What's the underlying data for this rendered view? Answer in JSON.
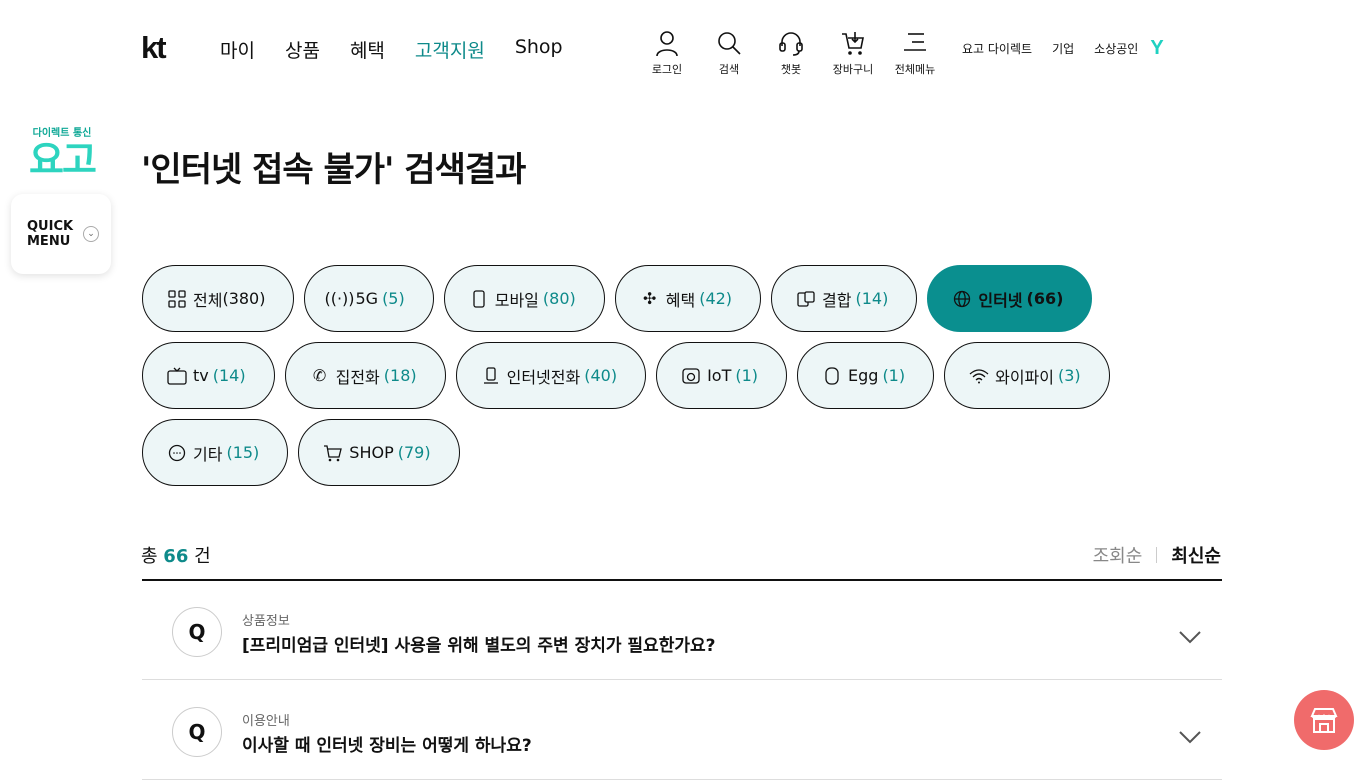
{
  "header": {
    "logo": "kt",
    "gnb": [
      "마이",
      "상품",
      "혜택",
      "고객지원",
      "Shop"
    ],
    "util": [
      {
        "label": "로그인",
        "icon": "user-icon"
      },
      {
        "label": "검색",
        "icon": "search-icon"
      },
      {
        "label": "챗봇",
        "icon": "headset-icon"
      },
      {
        "label": "장바구니",
        "icon": "cart-icon"
      },
      {
        "label": "전체메뉴",
        "icon": "menu-icon"
      }
    ],
    "toplinks": [
      "요고 다이렉트",
      "기업",
      "소상공인"
    ],
    "y_logo": "Y"
  },
  "quick": {
    "badge_small": "다이렉트 통신",
    "badge_big": "요고",
    "label_line1": "QUICK",
    "label_line2": "MENU"
  },
  "page": {
    "title": "'인터넷 접속 불가' 검색결과"
  },
  "chips": [
    {
      "label": "전체",
      "count": "(380)",
      "icon": "grid-icon"
    },
    {
      "label": "5G",
      "count": "(5)",
      "icon": "signal-icon"
    },
    {
      "label": "모바일",
      "count": "(80)",
      "icon": "mobile-icon"
    },
    {
      "label": "혜택",
      "count": "(42)",
      "icon": "gift-icon"
    },
    {
      "label": "결합",
      "count": "(14)",
      "icon": "combine-icon"
    },
    {
      "label": "인터넷",
      "count": "(66)",
      "icon": "globe-icon"
    },
    {
      "label": "tv",
      "count": "(14)",
      "icon": "tv-icon"
    },
    {
      "label": "집전화",
      "count": "(18)",
      "icon": "phone-icon"
    },
    {
      "label": "인터넷전화",
      "count": "(40)",
      "icon": "desk-phone-icon"
    },
    {
      "label": "IoT",
      "count": "(1)",
      "icon": "camera-icon"
    },
    {
      "label": "Egg",
      "count": "(1)",
      "icon": "egg-icon"
    },
    {
      "label": "와이파이",
      "count": "(3)",
      "icon": "wifi-icon"
    },
    {
      "label": "기타",
      "count": "(15)",
      "icon": "more-icon"
    },
    {
      "label": "SHOP",
      "count": "(79)",
      "icon": "cart-icon"
    }
  ],
  "result": {
    "prefix": "총",
    "count": "66",
    "suffix": "건"
  },
  "sort": {
    "option1": "조회순",
    "option2": "최신순"
  },
  "faqs": [
    {
      "q": "Q",
      "category": "상품정보",
      "question": "[프리미엄급 인터넷] 사용을 위해 별도의 주변 장치가 필요한가요?"
    },
    {
      "q": "Q",
      "category": "이용안내",
      "question": "이사할 때 인터넷 장비는 어떻게 하나요?"
    }
  ],
  "colors": {
    "accent": "#0a8f8f",
    "chip_bg": "#edf6f7",
    "fab": "#f06b6b"
  }
}
